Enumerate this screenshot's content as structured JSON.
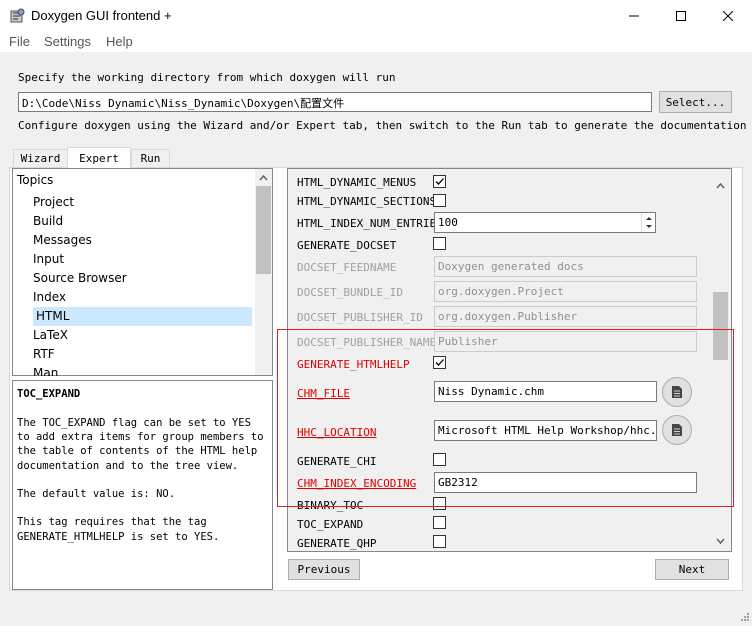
{
  "window": {
    "title": "Doxygen GUI frontend +"
  },
  "menu": [
    "File",
    "Settings",
    "Help"
  ],
  "workdir": {
    "label": "Specify the working directory from which doxygen will run",
    "value": "D:\\Code\\Niss Dynamic\\Niss_Dynamic\\Doxygen\\配置文件",
    "select_button": "Select..."
  },
  "instructions": "Configure doxygen using the Wizard and/or Expert tab, then switch to the Run tab to generate the documentation",
  "tabs": [
    "Wizard",
    "Expert",
    "Run"
  ],
  "topics": {
    "header": "Topics",
    "items": [
      "Project",
      "Build",
      "Messages",
      "Input",
      "Source Browser",
      "Index",
      "HTML",
      "LaTeX",
      "RTF",
      "Man"
    ],
    "selected": "HTML"
  },
  "help": {
    "title": "TOC_EXPAND",
    "body": "The TOC_EXPAND flag can be set to YES\nto add extra items for group members to\nthe table of contents of the HTML help\ndocumentation and to the tree view.\n\nThe default value is: NO.\n\nThis tag requires that the tag\nGENERATE_HTMLHELP is set to YES."
  },
  "settings": {
    "html_dynamic_menus": "HTML_DYNAMIC_MENUS",
    "html_dynamic_sections": "HTML_DYNAMIC_SECTIONS",
    "html_index_num_entries": "HTML_INDEX_NUM_ENTRIES",
    "html_index_num_entries_value": "100",
    "generate_docset": "GENERATE_DOCSET",
    "docset_feedname": "DOCSET_FEEDNAME",
    "docset_feedname_value": "Doxygen generated docs",
    "docset_bundle_id": "DOCSET_BUNDLE_ID",
    "docset_bundle_id_value": "org.doxygen.Project",
    "docset_publisher_id": "DOCSET_PUBLISHER_ID",
    "docset_publisher_id_value": "org.doxygen.Publisher",
    "docset_publisher_name": "DOCSET_PUBLISHER_NAME",
    "docset_publisher_name_value": "Publisher",
    "generate_htmlhelp": "GENERATE_HTMLHELP",
    "chm_file": "CHM_FILE",
    "chm_file_value": "Niss Dynamic.chm",
    "hhc_location": "HHC_LOCATION",
    "hhc_location_value": "Microsoft HTML Help Workshop/hhc.exe",
    "generate_chi": "GENERATE_CHI",
    "chm_index_encoding": "CHM_INDEX_ENCODING",
    "chm_index_encoding_value": "GB2312",
    "binary_toc": "BINARY_TOC",
    "toc_expand": "TOC_EXPAND",
    "generate_qhp": "GENERATE_QHP"
  },
  "nav": {
    "previous": "Previous",
    "next": "Next"
  },
  "colors": {
    "highlight": "#e02020",
    "modified_label": "#e00000"
  }
}
